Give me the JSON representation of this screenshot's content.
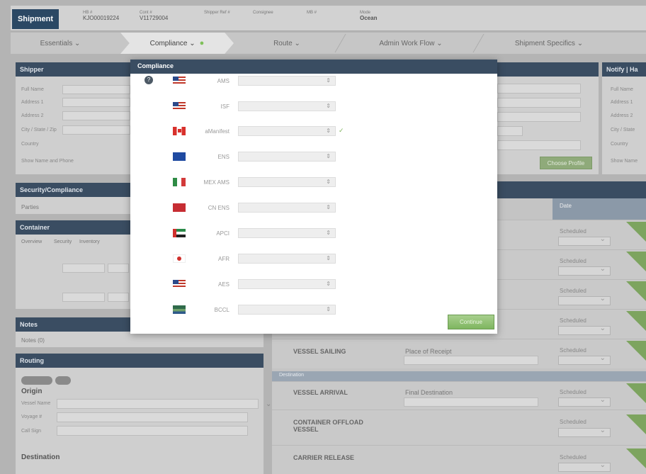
{
  "header": {
    "badge": "Shipment",
    "meta": [
      {
        "label": "HB #",
        "value": "KJO00019224"
      },
      {
        "label": "Cont #",
        "value": "V11729004"
      },
      {
        "label": "Shipper Ref #",
        "value": ""
      },
      {
        "label": "Consignee",
        "value": ""
      },
      {
        "label": "MB #",
        "value": ""
      },
      {
        "label": "Mode",
        "value": "Ocean"
      }
    ]
  },
  "tabs": [
    "Essentials",
    "Compliance",
    "Route",
    "Admin Work Flow",
    "Shipment Specifics"
  ],
  "shipper": {
    "title": "Shipper",
    "fields": [
      "Full Name",
      "Address 1",
      "Address 2",
      "City / State / Zip",
      "Country"
    ],
    "show_link": "Show Name and Phone"
  },
  "notify": {
    "title": "Notify | Ha",
    "fields": [
      "Full Name",
      "Address 1",
      "Address 2",
      "City / State",
      "Country"
    ],
    "show_link": "Show Name"
  },
  "choose_profile": "Choose Profile",
  "security": {
    "title": "Security/Compliance",
    "parties": "Parties"
  },
  "container": {
    "title": "Container",
    "tabs": [
      "Overview",
      "Security",
      "Inventory"
    ]
  },
  "notes": {
    "title": "Notes",
    "link": "Notes (0)"
  },
  "routing": {
    "title": "Routing",
    "origin": "Origin",
    "fields": [
      "Vessel Name",
      "Voyage #",
      "Call Sign"
    ],
    "destination": "Destination"
  },
  "workflow": {
    "status_head": "Date",
    "section": "Destination",
    "rows": [
      {
        "name": "",
        "place": "",
        "status": "Scheduled"
      },
      {
        "name": "",
        "place": "",
        "status": "Scheduled"
      },
      {
        "name": "",
        "place": "",
        "status": "Scheduled"
      },
      {
        "name": "",
        "place": "",
        "status": "Scheduled"
      },
      {
        "name": "VESSEL SAILING",
        "place": "Place of Receipt",
        "status": "Scheduled"
      },
      {
        "name": "VESSEL ARRIVAL",
        "place": "Final Destination",
        "status": "Scheduled"
      },
      {
        "name": "CONTAINER OFFLOAD VESSEL",
        "place": "",
        "status": "Scheduled"
      },
      {
        "name": "CARRIER RELEASE",
        "place": "",
        "status": "Scheduled"
      }
    ]
  },
  "modal": {
    "title": "Compliance",
    "continue": "Continue",
    "rows": [
      {
        "label": "AMS",
        "flag": "us-flag"
      },
      {
        "label": "ISF",
        "flag": "us-flag"
      },
      {
        "label": "aManifest",
        "flag": "canada-flag"
      },
      {
        "label": "ENS",
        "flag": "eu-flag"
      },
      {
        "label": "MEX AMS",
        "flag": "mexico-flag"
      },
      {
        "label": "CN ENS",
        "flag": "china-flag"
      },
      {
        "label": "APCI",
        "flag": "uae-flag"
      },
      {
        "label": "AFR",
        "flag": "japan-flag"
      },
      {
        "label": "AES",
        "flag": "us-flag"
      },
      {
        "label": "BCCL",
        "flag": "other-flag"
      }
    ]
  }
}
